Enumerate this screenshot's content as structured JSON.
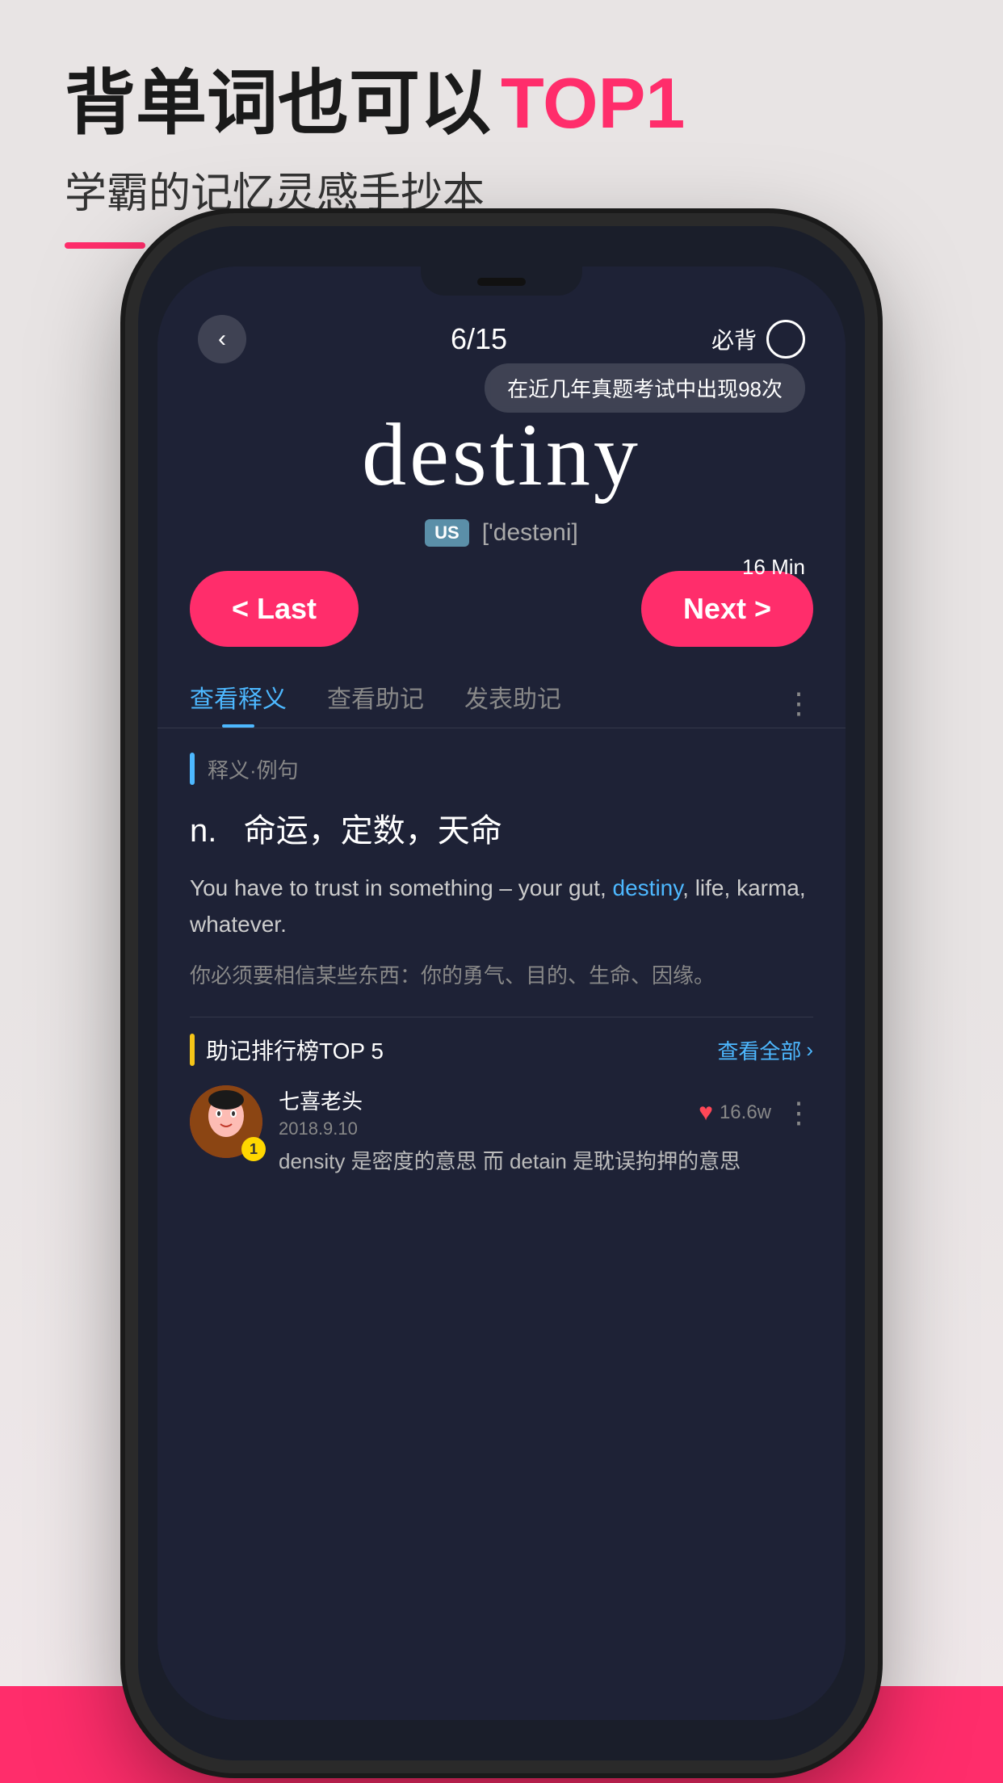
{
  "header": {
    "title_part1": "背单词也可以",
    "title_highlight": "TOP1",
    "subtitle": "学霸的记忆灵感手抄本",
    "underline": true
  },
  "phone": {
    "status": {
      "progress": "6/15",
      "must_memorize": "必背",
      "tooltip": "在近几年真题考试中出现98次"
    },
    "word": {
      "text": "destiny",
      "us_label": "US",
      "phonetic": "['destəni]"
    },
    "timer": "16 Min",
    "nav": {
      "last_label": "< Last",
      "next_label": "Next >"
    },
    "tabs": [
      {
        "label": "查看释义",
        "active": true
      },
      {
        "label": "查看助记",
        "active": false
      },
      {
        "label": "发表助记",
        "active": false
      }
    ],
    "definition": {
      "section_label": "释义·例句",
      "pos": "n.",
      "meanings": "命运，定数，天命",
      "example_en": "You have to trust in something – your gut, destiny, life, karma, whatever.",
      "example_en_highlight": "destiny",
      "example_zh": "你必须要相信某些东西：你的勇气、目的、生命、因缘。"
    },
    "memory": {
      "section_label": "助记排行榜TOP 5",
      "view_all": "查看全部",
      "top_user": {
        "name": "七喜老头",
        "date": "2018.9.10",
        "rank": "1",
        "likes": "16.6w",
        "comment": "density 是密度的意思  而 detain 是耽误拘押的意思"
      }
    }
  },
  "colors": {
    "accent_pink": "#ff2d6b",
    "accent_blue": "#4db8ff",
    "bg_dark": "#1e2236",
    "text_white": "#ffffff",
    "text_gray": "#888888"
  }
}
